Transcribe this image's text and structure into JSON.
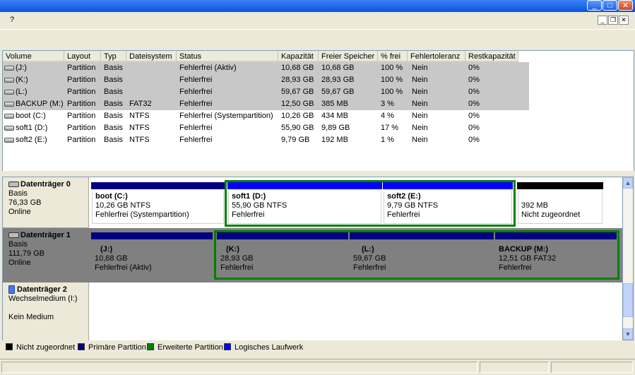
{
  "menu": {
    "help": "?"
  },
  "window_buttons": {
    "minimize": "_",
    "maximize": "□",
    "close": "✕"
  },
  "mdi_buttons": {
    "minimize": "_",
    "restore": "❐",
    "close": "✕"
  },
  "volume_list": {
    "columns": [
      "Volume",
      "Layout",
      "Typ",
      "Dateisystem",
      "Status",
      "Kapazität",
      "Freier Speicher",
      "% frei",
      "Fehlertoleranz",
      "Restkapazität"
    ],
    "rows": [
      {
        "volume": "(J:)",
        "layout": "Partition",
        "typ": "Basis",
        "fs": "",
        "status": "Fehlerfrei (Aktiv)",
        "kap": "10,68 GB",
        "frei": "10,68 GB",
        "pct": "100 %",
        "ft": "Nein",
        "rest": "0%",
        "selected": true
      },
      {
        "volume": "(K:)",
        "layout": "Partition",
        "typ": "Basis",
        "fs": "",
        "status": "Fehlerfrei",
        "kap": "28,93 GB",
        "frei": "28,93 GB",
        "pct": "100 %",
        "ft": "Nein",
        "rest": "0%",
        "selected": true
      },
      {
        "volume": "(L:)",
        "layout": "Partition",
        "typ": "Basis",
        "fs": "",
        "status": "Fehlerfrei",
        "kap": "59,67 GB",
        "frei": "59,67 GB",
        "pct": "100 %",
        "ft": "Nein",
        "rest": "0%",
        "selected": true
      },
      {
        "volume": "BACKUP (M:)",
        "layout": "Partition",
        "typ": "Basis",
        "fs": "FAT32",
        "status": "Fehlerfrei",
        "kap": "12,50 GB",
        "frei": "385 MB",
        "pct": "3 %",
        "ft": "Nein",
        "rest": "0%",
        "selected": true
      },
      {
        "volume": "boot (C:)",
        "layout": "Partition",
        "typ": "Basis",
        "fs": "NTFS",
        "status": "Fehlerfrei (Systempartition)",
        "kap": "10,26 GB",
        "frei": "434 MB",
        "pct": "4 %",
        "ft": "Nein",
        "rest": "0%",
        "selected": false
      },
      {
        "volume": "soft1 (D:)",
        "layout": "Partition",
        "typ": "Basis",
        "fs": "NTFS",
        "status": "Fehlerfrei",
        "kap": "55,90 GB",
        "frei": "9,89 GB",
        "pct": "17 %",
        "ft": "Nein",
        "rest": "0%",
        "selected": false
      },
      {
        "volume": "soft2 (E:)",
        "layout": "Partition",
        "typ": "Basis",
        "fs": "NTFS",
        "status": "Fehlerfrei",
        "kap": "9,79 GB",
        "frei": "192 MB",
        "pct": "1 %",
        "ft": "Nein",
        "rest": "0%",
        "selected": false
      }
    ]
  },
  "disks": [
    {
      "title": "Datenträger 0",
      "line1": "Basis",
      "line2": "76,33 GB",
      "line3": "Online"
    },
    {
      "title": "Datenträger 1",
      "line1": "Basis",
      "line2": "111,79 GB",
      "line3": "Online"
    },
    {
      "title": "Datenträger 2",
      "line1": "Wechselmedium (I:)",
      "line2": "",
      "line3": "Kein Medium"
    }
  ],
  "disk0_parts": {
    "boot": {
      "name": "boot  (C:)",
      "size": "10,26 GB NTFS",
      "status": "Fehlerfrei (Systempartition)"
    },
    "soft1": {
      "name": "soft1  (D:)",
      "size": "55,90 GB NTFS",
      "status": "Fehlerfrei"
    },
    "soft2": {
      "name": "soft2  (E:)",
      "size": "9,79 GB NTFS",
      "status": "Fehlerfrei"
    },
    "unalloc": {
      "size": "392 MB",
      "status": "Nicht zugeordnet"
    }
  },
  "disk1_parts": {
    "j": {
      "name": "(J:)",
      "size": "10,68 GB",
      "status": "Fehlerfrei (Aktiv)"
    },
    "k": {
      "name": "(K:)",
      "size": "28,93 GB",
      "status": "Fehlerfrei"
    },
    "l": {
      "name": "(L:)",
      "size": "59,67 GB",
      "status": "Fehlerfrei"
    },
    "m": {
      "name": "BACKUP  (M:)",
      "size": "12,51 GB FAT32",
      "status": "Fehlerfrei"
    }
  },
  "legend": [
    {
      "label": "Nicht zugeordnet",
      "color": "#000000"
    },
    {
      "label": "Primäre Partition",
      "color": "#000080"
    },
    {
      "label": "Erweiterte Partition",
      "color": "#008000"
    },
    {
      "label": "Logisches Laufwerk",
      "color": "#0000ff"
    }
  ],
  "colors": {
    "primary": "#000080",
    "logical": "#0000ff",
    "extended": "#008000",
    "unallocated": "#000000"
  }
}
